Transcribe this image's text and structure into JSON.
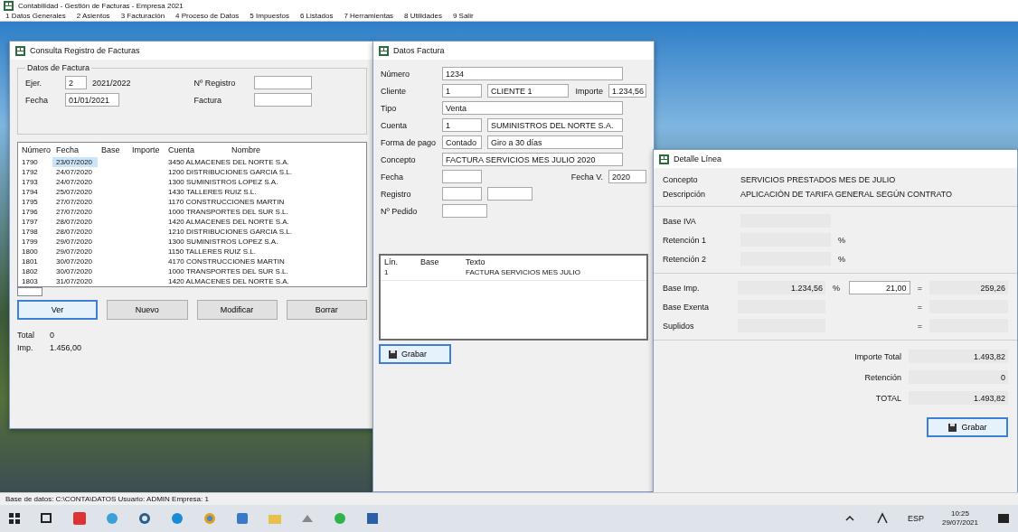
{
  "app": {
    "title": "Contabilidad - Gestión de Facturas - Empresa 2021",
    "menu": [
      "1 Datos Generales",
      "2 Asientos",
      "3 Facturación",
      "4 Proceso de Datos",
      "5 Impuestos",
      "6 Listados",
      "7 Herramientas",
      "8 Utilidades",
      "9 Salir"
    ]
  },
  "list_window": {
    "title": "Consulta Registro de Facturas",
    "group_title": "Datos de Factura",
    "fields": [
      {
        "label": "Ejer.",
        "value": "2",
        "value_2": "2021/2022"
      },
      {
        "label": "Fecha",
        "value": "01/01/2021"
      }
    ],
    "fields_right": [
      {
        "label": "Nº Registro"
      },
      {
        "label": "Factura"
      }
    ],
    "columns": [
      "Número",
      "Fecha",
      "Base",
      "Importe",
      "Cuenta",
      "Nombre"
    ],
    "rows": [
      {
        "number": "1790",
        "date": "23/07/2020",
        "description": "3450 ALMACENES DEL NORTE S.A.",
        "selected": true
      },
      {
        "number": "1792",
        "date": "24/07/2020",
        "description": "1200 DISTRIBUCIONES GARCIA S.L.",
        "selected": false
      },
      {
        "number": "1793",
        "date": "24/07/2020",
        "description": "1300 SUMINISTROS LOPEZ S.A.",
        "selected": false
      },
      {
        "number": "1794",
        "date": "25/07/2020",
        "description": "1430 TALLERES RUIZ S.L.",
        "selected": false
      },
      {
        "number": "1795",
        "date": "27/07/2020",
        "description": "1170 CONSTRUCCIONES MARTIN",
        "selected": false
      },
      {
        "number": "1796",
        "date": "27/07/2020",
        "description": "1000 TRANSPORTES DEL SUR S.L.",
        "selected": false
      },
      {
        "number": "1797",
        "date": "28/07/2020",
        "description": "1420 ALMACENES DEL NORTE S.A.",
        "selected": false
      },
      {
        "number": "1798",
        "date": "28/07/2020",
        "description": "1210 DISTRIBUCIONES GARCIA S.L.",
        "selected": false
      },
      {
        "number": "1799",
        "date": "29/07/2020",
        "description": "1300 SUMINISTROS LOPEZ S.A.",
        "selected": false
      },
      {
        "number": "1800",
        "date": "29/07/2020",
        "description": "1150 TALLERES RUIZ S.L.",
        "selected": false
      },
      {
        "number": "1801",
        "date": "30/07/2020",
        "description": "4170 CONSTRUCCIONES MARTIN",
        "selected": false
      },
      {
        "number": "1802",
        "date": "30/07/2020",
        "description": "1000 TRANSPORTES DEL SUR S.L.",
        "selected": false
      },
      {
        "number": "1803",
        "date": "31/07/2020",
        "description": "1420 ALMACENES DEL NORTE S.A.",
        "selected": false
      }
    ],
    "buttons": [
      {
        "label": "Ver",
        "default": true
      },
      {
        "label": "Nuevo",
        "default": false
      },
      {
        "label": "Modificar",
        "default": false
      },
      {
        "label": "Borrar",
        "default": false
      }
    ],
    "summary": [
      {
        "label": "Total",
        "value": "0"
      },
      {
        "label": "Imp.",
        "value": "1.456,00"
      }
    ]
  },
  "invoice_window": {
    "title": "Datos Factura",
    "fields": [
      {
        "kind": "text",
        "label": "Número",
        "value": "1234"
      },
      {
        "kind": "code_amount",
        "label": "Cliente",
        "value": "1",
        "value_2": "CLIENTE 1",
        "label_2": "Importe",
        "value_3": "1.234,56"
      },
      {
        "kind": "text",
        "label": "Tipo",
        "value": "Venta"
      },
      {
        "kind": "code",
        "label": "Cuenta",
        "value": "1",
        "value_2": "SUMINISTROS DEL NORTE S.A."
      },
      {
        "kind": "code",
        "label": "Forma de pago",
        "value": "Contado",
        "value_2": "Giro a 30 días"
      },
      {
        "kind": "text",
        "label": "Concepto",
        "value": "FACTURA SERVICIOS MES JULIO 2020"
      },
      {
        "kind": "date_pair",
        "label": "Fecha",
        "label_2": "Fecha V.",
        "value_2": "2020"
      },
      {
        "kind": "range",
        "label": "Registro"
      },
      {
        "kind": "empty",
        "label": "Nº Pedido"
      }
    ],
    "columns": [
      "Lín.",
      "Base",
      "Texto"
    ],
    "rows": [
      [
        "1",
        "",
        "FACTURA SERVICIOS MES JULIO"
      ]
    ],
    "button": "Grabar"
  },
  "line_window": {
    "title": "Detalle Línea",
    "fields": [
      {
        "label": "Concepto",
        "value": "SERVICIOS PRESTADOS MES DE JULIO"
      },
      {
        "label": "Descripción",
        "value": "APLICACIÓN DE TARIFA GENERAL SEGÚN CONTRATO"
      }
    ],
    "taxes": [
      {
        "label": "Base IVA"
      },
      {
        "label": "Retención 1",
        "mark": "%"
      },
      {
        "label": "Retención 2",
        "mark": "%"
      }
    ],
    "amounts": [
      {
        "label": "Base Imp.",
        "value": "1.234,56",
        "mark": "%",
        "rate": "21,00",
        "sign": "=",
        "result": "259,26"
      },
      {
        "label": "Base Exenta",
        "sign": "="
      },
      {
        "label": "Suplidos",
        "sign": "="
      }
    ],
    "totals": [
      {
        "label": "Importe Total",
        "value": "1.493,82"
      },
      {
        "label": "Retención",
        "value": "0"
      },
      {
        "label": "TOTAL",
        "value": "1.493,82"
      }
    ],
    "button": "Grabar"
  },
  "status_bar": "Base de datos: C:\\CONTA\\DATOS  Usuario: ADMIN  Empresa: 1",
  "taskbar": {
    "clock_time": "10:25",
    "clock_date": "29/07/2021",
    "tray_label": "ESP"
  }
}
